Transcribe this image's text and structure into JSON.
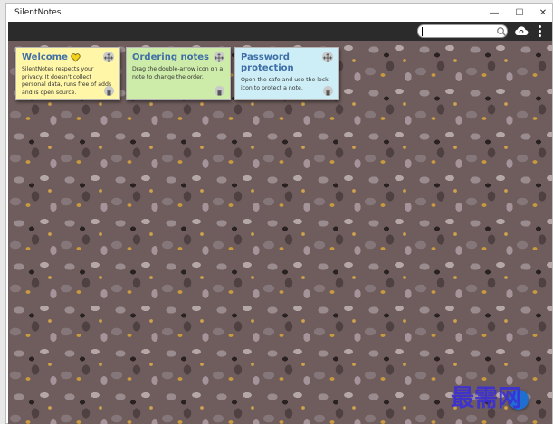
{
  "window": {
    "title": "SilentNotes",
    "controls": {
      "minimize": "—",
      "maximize": "☐",
      "close": "✕"
    }
  },
  "toolbar": {
    "search": {
      "placeholder": "",
      "value": ""
    },
    "icons": [
      "search-icon",
      "cloud-sync-icon",
      "more-vert-icon"
    ]
  },
  "notes": [
    {
      "title": "Welcome",
      "title_icon": "heart-icon",
      "body": "SilentNotes respects your privacy. It doesn't collect personal data, runs free of adds and is open source.",
      "color": "#fff6a8"
    },
    {
      "title": "Ordering notes",
      "body": "Drag the double-arrow icon on a note to change the order.",
      "color": "#cdeba9"
    },
    {
      "title": "Password protection",
      "body": "Open the safe and use the lock icon to protect a note.",
      "color": "#cdeef7"
    }
  ],
  "watermark": "最需网",
  "colors": {
    "toolbar": "#2b2b2b",
    "note_title": "#3f6fa6",
    "fab": "#1f6fd1"
  }
}
